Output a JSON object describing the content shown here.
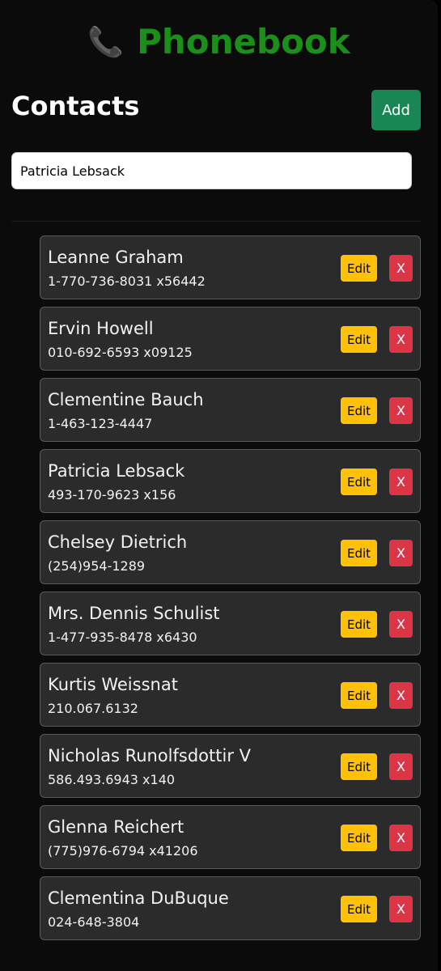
{
  "header": {
    "icon": "phone-icon",
    "title": "Phonebook"
  },
  "section": {
    "heading": "Contacts",
    "add_label": "Add"
  },
  "search": {
    "value": "Patricia Lebsack"
  },
  "buttons": {
    "edit": "Edit",
    "delete": "X"
  },
  "contacts": [
    {
      "name": "Leanne Graham",
      "phone": "1-770-736-8031 x56442"
    },
    {
      "name": "Ervin Howell",
      "phone": "010-692-6593 x09125"
    },
    {
      "name": "Clementine Bauch",
      "phone": "1-463-123-4447"
    },
    {
      "name": "Patricia Lebsack",
      "phone": "493-170-9623 x156"
    },
    {
      "name": "Chelsey Dietrich",
      "phone": "(254)954-1289"
    },
    {
      "name": "Mrs. Dennis Schulist",
      "phone": "1-477-935-8478 x6430"
    },
    {
      "name": "Kurtis Weissnat",
      "phone": "210.067.6132"
    },
    {
      "name": "Nicholas Runolfsdottir V",
      "phone": "586.493.6943 x140"
    },
    {
      "name": "Glenna Reichert",
      "phone": "(775)976-6794 x41206"
    },
    {
      "name": "Clementina DuBuque",
      "phone": "024-648-3804"
    }
  ],
  "colors": {
    "title": "#1a8f1a",
    "add": "#198754",
    "edit": "#ffc107",
    "delete": "#dc3545"
  }
}
